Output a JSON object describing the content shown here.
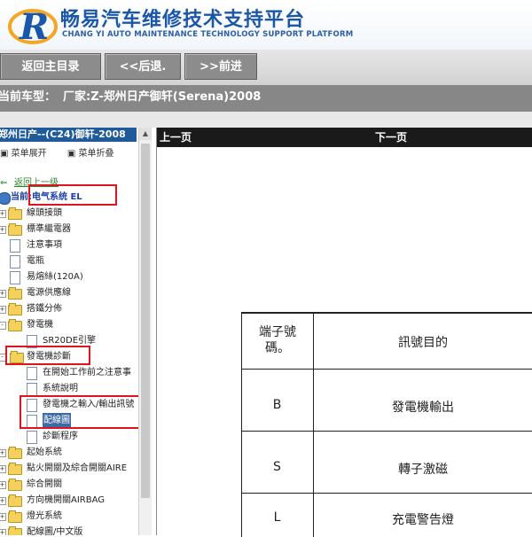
{
  "header": {
    "title_cn": "畅易汽车维修技术支持平台",
    "title_en": "CHANG YI AUTO MAINTENANCE TECHNOLOGY SUPPORT PLATFORM"
  },
  "toolbar": {
    "home_label": "返回主目录",
    "back_label": "<<后退.",
    "forward_label": ">>前进"
  },
  "vehicle": {
    "label": "当前车型：",
    "value": "厂家:Z-郑州日产御轩(Serena)2008"
  },
  "tree": {
    "header": "郑州日产--(C24)御轩-2008",
    "expand_label": "菜单展开",
    "collapse_label": "菜单折叠",
    "items": [
      {
        "label": "返回上一级"
      },
      {
        "label": "当前:电气系统 EL"
      },
      {
        "label": "線頭接頭"
      },
      {
        "label": "標準繼電器"
      },
      {
        "label": "注意事項"
      },
      {
        "label": "電瓶"
      },
      {
        "label": "易熔絲(120A)"
      },
      {
        "label": "電源供應線"
      },
      {
        "label": "搭鐵分佈"
      },
      {
        "label": "發電機"
      },
      {
        "label": "SR20DE引擎"
      },
      {
        "label": "發電機診斷"
      },
      {
        "label": "在開始工作前之注意事"
      },
      {
        "label": "系統說明"
      },
      {
        "label": "發電機之輸入/輸出訊號"
      },
      {
        "label": "配線圖"
      },
      {
        "label": "診斷程序"
      },
      {
        "label": "起始系統"
      },
      {
        "label": "點火開關及綜合開關AIRE"
      },
      {
        "label": "綜合開關"
      },
      {
        "label": "方向機開關AIRBAG"
      },
      {
        "label": "燈光系統"
      },
      {
        "label": "配線圖/中文版"
      }
    ]
  },
  "content": {
    "prev_label": "上一页",
    "next_label": "下一页",
    "table": {
      "header": {
        "col1": "端子號碼。",
        "col2": "訊號目的"
      },
      "rows": [
        {
          "terminal": "B",
          "purpose": "發電機輸出"
        },
        {
          "terminal": "S",
          "purpose": "轉子激磁"
        },
        {
          "terminal": "L",
          "purpose": "充電警告燈"
        }
      ]
    }
  },
  "colors": {
    "brand_blue": "#1b57a8",
    "tree_header": "#1f5a9a",
    "selection": "#3d6aa4",
    "annotation_red": "#e0141e"
  }
}
